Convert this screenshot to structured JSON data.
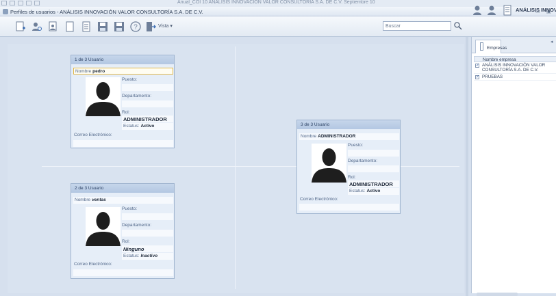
{
  "window": {
    "behind_title": "Anual_COI 10 ANÁLISIS INNOVACIÓN VALOR CONSULTORÍA S.A. DE C.V. Septiembre 10",
    "title": "Perfiles de usuarios - ANÁLISIS INNOVACIÓN VALOR CONSULTORÍA S.A. DE C.V.",
    "icon": "users-window-icon"
  },
  "toolbar": {
    "icons": [
      "new-user-icon",
      "find-user-icon",
      "edit-user-icon",
      "blank-document-icon",
      "export-icon",
      "save-icon",
      "save-as-icon",
      "help-icon",
      "exit-icon"
    ],
    "vista_label": "Vista",
    "search_placeholder": "Buscar",
    "search_icon": "search-icon"
  },
  "cards": [
    {
      "header": "1 de 3   Usuario",
      "nombre_label": "Nombre",
      "nombre": "pedro",
      "puesto_label": "Puesto:",
      "departamento_label": "Departamento:",
      "rol_label": "Rol:",
      "rol": "ADMINISTRADOR",
      "estatus_label": "Estatus:",
      "estatus": "Activo",
      "correo_label": "Correo Electrónico:"
    },
    {
      "header": "2 de 3   Usuario",
      "nombre_label": "Nombre",
      "nombre": "ventas",
      "puesto_label": "Puesto:",
      "departamento_label": "Departamento:",
      "rol_label": "Rol:",
      "rol": "Ninguno",
      "estatus_label": "Estatus:",
      "estatus": "Inactivo",
      "correo_label": "Correo Electrónico:"
    },
    {
      "header": "3 de 3   Usuario",
      "nombre_label": "Nombre",
      "nombre": "ADMINISTRADOR",
      "puesto_label": "Puesto:",
      "departamento_label": "Departamento:",
      "rol_label": "Rol:",
      "rol": "ADMINISTRADOR",
      "estatus_label": "Estatus:",
      "estatus": "Activo",
      "correo_label": "Correo Electrónico:"
    }
  ],
  "side_panel": {
    "heading": "ANÁLISIS INNOVA",
    "tab": "Empresas",
    "column": "Nombre empresa",
    "rows": [
      {
        "name": "ANÁLISIS INNOVACIÓN VALOR CONSULTORÍA S.A. DE C.V.",
        "checked": true
      },
      {
        "name": "PRUEBAS",
        "checked": true
      }
    ]
  },
  "colors": {
    "accent": "#b3c7e2",
    "canvas": "#d9e3f0",
    "focus": "#e0b74a"
  }
}
